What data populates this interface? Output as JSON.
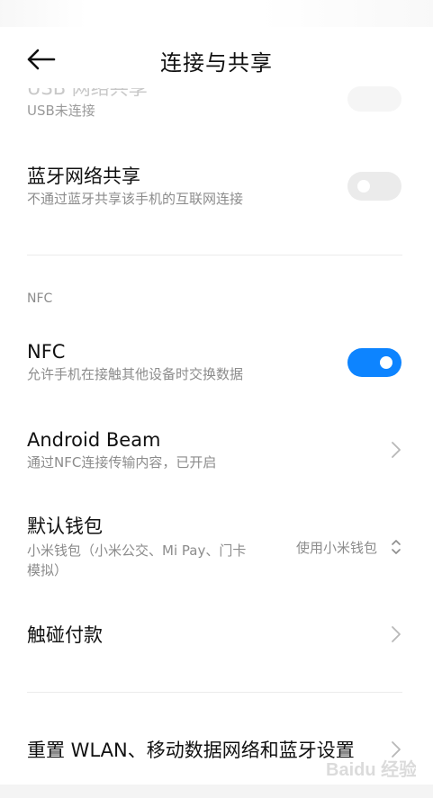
{
  "header": {
    "title": "连接与共享"
  },
  "usb_sharing": {
    "title": "USB 网络共享",
    "subtitle": "USB未连接"
  },
  "bluetooth_sharing": {
    "title": "蓝牙网络共享",
    "subtitle": "不通过蓝牙共享该手机的互联网连接",
    "enabled": false
  },
  "nfc_section": {
    "header": "NFC"
  },
  "nfc": {
    "title": "NFC",
    "subtitle": "允许手机在接触其他设备时交换数据",
    "enabled": true
  },
  "android_beam": {
    "title": "Android Beam",
    "subtitle": "通过NFC连接传输内容，已开启"
  },
  "default_wallet": {
    "title": "默认钱包",
    "subtitle_line1": "小米钱包（小米公交、Mi Pay、门卡",
    "subtitle_line2": "模拟）",
    "value": "使用小米钱包"
  },
  "tap_pay": {
    "title": "触碰付款"
  },
  "reset": {
    "title": "重置 WLAN、移动数据网络和蓝牙设置"
  },
  "watermark": {
    "text": "Baidu 经验"
  },
  "colors": {
    "accent": "#0d84ff",
    "toggle_off": "#ebebeb"
  }
}
